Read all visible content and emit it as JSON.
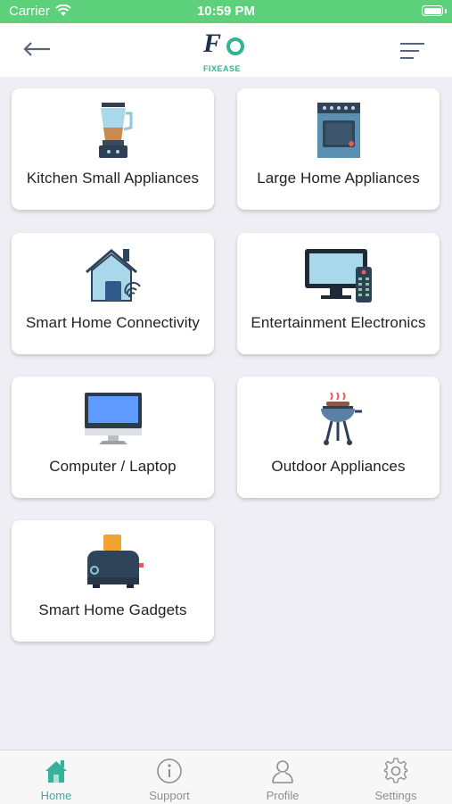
{
  "status_bar": {
    "carrier": "Carrier",
    "time": "10:59 PM"
  },
  "header": {
    "logo_text": "FIXEASE",
    "logo_mark": "FE"
  },
  "colors": {
    "status": "#5cd07b",
    "accent": "#35b29a",
    "text": "#222222",
    "background": "#efeef4"
  },
  "categories": [
    {
      "label": "Kitchen Small Appliances",
      "icon": "blender-icon"
    },
    {
      "label": "Large Home Appliances",
      "icon": "oven-icon"
    },
    {
      "label": "Smart Home Connectivity",
      "icon": "smart-home-icon"
    },
    {
      "label": "Entertainment Electronics",
      "icon": "tv-remote-icon"
    },
    {
      "label": "Computer / Laptop",
      "icon": "monitor-icon"
    },
    {
      "label": "Outdoor Appliances",
      "icon": "grill-icon"
    },
    {
      "label": "Smart Home Gadgets",
      "icon": "toaster-icon"
    }
  ],
  "tabs": [
    {
      "label": "Home",
      "icon": "home-icon",
      "active": true
    },
    {
      "label": "Support",
      "icon": "info-icon",
      "active": false
    },
    {
      "label": "Profile",
      "icon": "person-icon",
      "active": false
    },
    {
      "label": "Settings",
      "icon": "gear-icon",
      "active": false
    }
  ]
}
